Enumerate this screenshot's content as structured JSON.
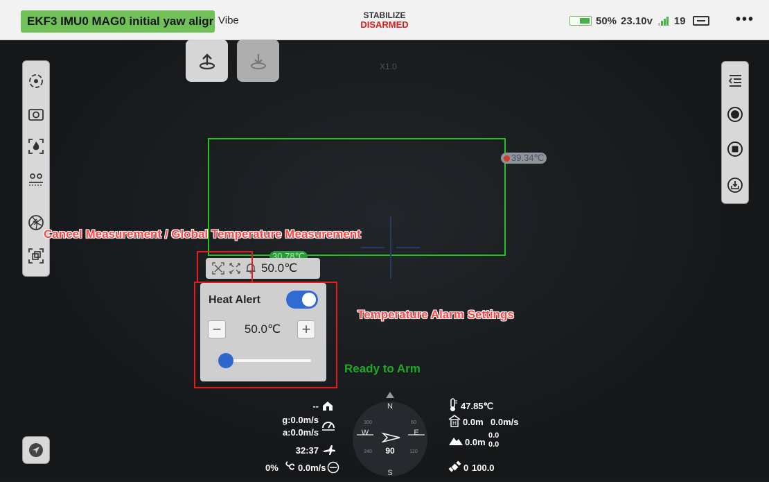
{
  "topbar": {
    "alert_text": "EKF3 IMU0 MAG0 initial yaw aligr",
    "vibe_label": "Vibe",
    "flight_mode": "STABILIZE",
    "arm_state": "DISARMED",
    "battery_percent": "50%",
    "battery_voltage": "23.10v",
    "satellite_count": "19",
    "more_label": "•••",
    "battery_level": 0.5
  },
  "video": {
    "zoom_label": "X1.0",
    "max_temp_chip": "39.34℃",
    "min_temp_chip": "30.78℃"
  },
  "annotations": {
    "cancel_measure": "Cancel Measurement / Global Temperature Measurement",
    "alarm_settings": "Temperature Alarm Settings"
  },
  "measure_bar": {
    "alarm_temp": "50.0℃"
  },
  "heat_alert": {
    "label": "Heat Alert",
    "enabled": true,
    "value": "50.0℃",
    "minus_label": "−",
    "plus_label": "+",
    "slider_fraction": 0.05
  },
  "status": {
    "ready": "Ready to Arm"
  },
  "telemetry": {
    "home_distance": "--",
    "ground_speed": "g:0.0m/s",
    "air_speed": "a:0.0m/s",
    "flight_time": "32:37",
    "throttle_percent": "0%",
    "climb_rate": "0.0m/s",
    "temperature": "47.85℃",
    "height": "0.0m",
    "vertical_speed": "0.0m/s",
    "altitude": "0.0m",
    "alt_top": "0.0",
    "alt_bottom": "0.0",
    "gps_sats": "0",
    "gps_hdop": "100.0"
  },
  "compass": {
    "heading": "90",
    "n": "N",
    "s": "S",
    "e": "E",
    "w": "W",
    "tick_300": "300",
    "tick_60": "60",
    "tick_240": "240",
    "tick_120": "120"
  },
  "colors": {
    "banner_green": "#6fc158",
    "box_green": "#21c421",
    "annot_red": "#ff4545",
    "toggle_blue": "#2f6bd1",
    "ready_green": "#1dab24"
  }
}
